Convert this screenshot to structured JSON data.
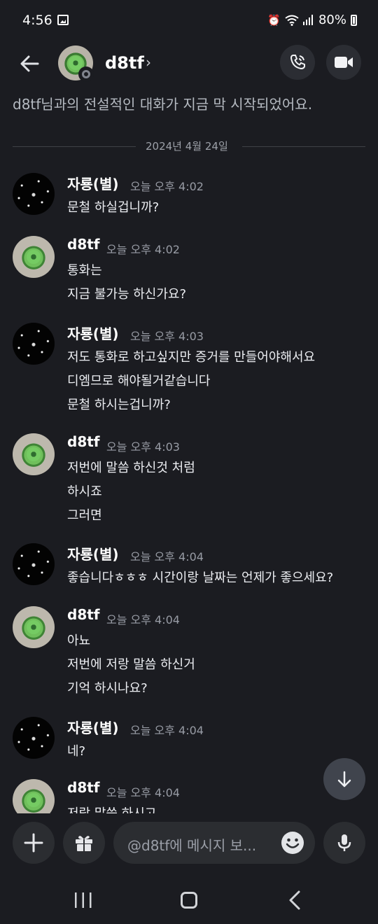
{
  "status_bar": {
    "time": "4:56",
    "battery": "80%"
  },
  "header": {
    "name": "d8tf",
    "chevron": "›"
  },
  "intro": "d8tf님과의 전설적인 대화가 지금 막 시작되었어요.",
  "date_divider": "2024년 4월 24일",
  "messages": [
    {
      "author": "자룡(별)",
      "time": "오늘 오후 4:02",
      "avatar": "starfield",
      "lines": [
        "문철 하실겁니까?"
      ]
    },
    {
      "author": "d8tf",
      "time": "오늘 오후 4:02",
      "avatar": "turtle",
      "lines": [
        "통화는",
        "지금 불가능 하신가요?"
      ]
    },
    {
      "author": "자룡(별)",
      "time": "오늘 오후 4:03",
      "avatar": "starfield",
      "lines": [
        "저도 통화로 하고싶지만 증거를 만들어야해서요",
        "디엠므로 해야될거같습니다",
        "문철 하시는겁니까?"
      ]
    },
    {
      "author": "d8tf",
      "time": "오늘 오후 4:03",
      "avatar": "turtle",
      "lines": [
        "저번에 말씀 하신것 처럼",
        "하시죠",
        "그러면"
      ]
    },
    {
      "author": "자룡(별)",
      "time": "오늘 오후 4:04",
      "avatar": "starfield",
      "lines": [
        "좋습니다ㅎㅎㅎ 시간이랑 날짜는 언제가 좋으세요?"
      ]
    },
    {
      "author": "d8tf",
      "time": "오늘 오후 4:04",
      "avatar": "turtle",
      "lines": [
        "아뇨",
        "저번에 저랑 말씀 하신거",
        "기억 하시나요?"
      ]
    },
    {
      "author": "자룡(별)",
      "time": "오늘 오후 4:04",
      "avatar": "starfield",
      "lines": [
        "네?"
      ]
    },
    {
      "author": "d8tf",
      "time": "오늘 오후 4:04",
      "avatar": "turtle",
      "lines": [
        "저랑 말씀 하시고"
      ]
    }
  ],
  "composer": {
    "placeholder": "@d8tf에 메시지 보..."
  },
  "icons": {
    "back": "arrow-left-icon",
    "call": "phone-icon",
    "video": "video-camera-icon",
    "scroll_down": "arrow-down-icon",
    "plus": "plus-icon",
    "gift": "gift-icon",
    "emoji": "emoji-icon",
    "mic": "microphone-icon"
  }
}
